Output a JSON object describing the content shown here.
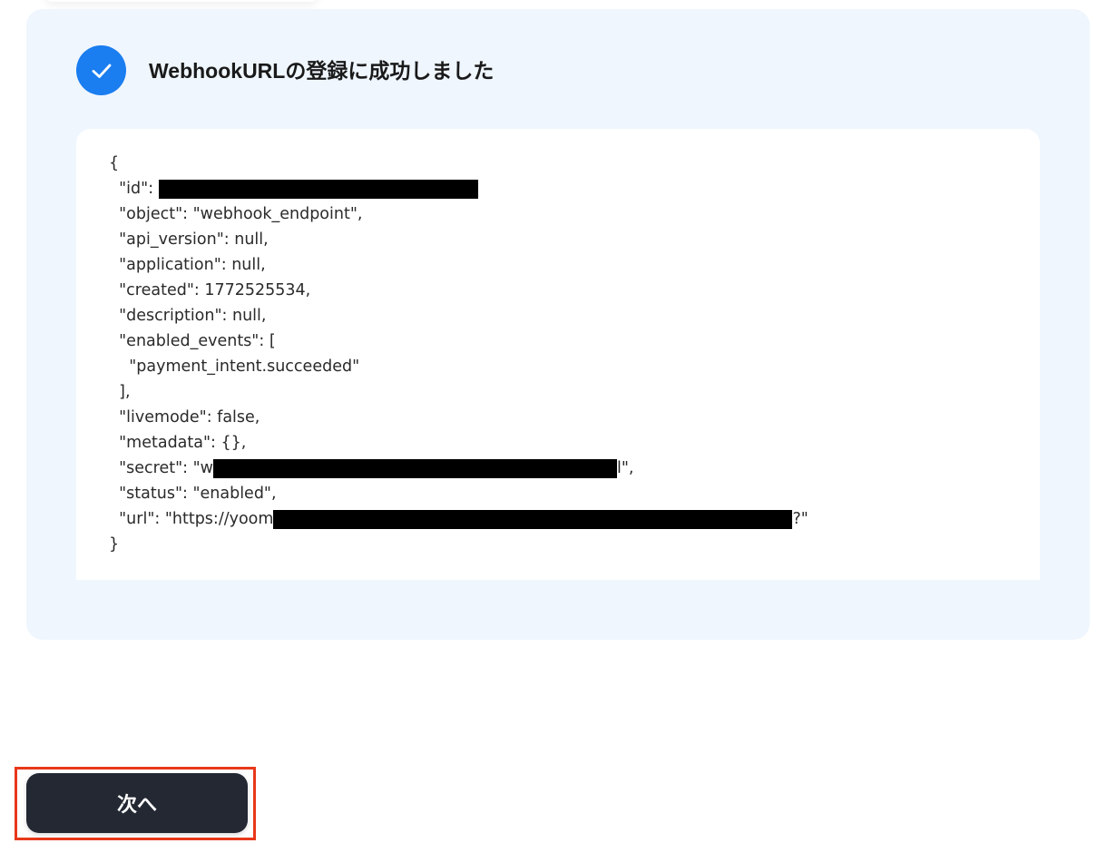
{
  "header": {
    "title": "WebhookURLの登録に成功しました"
  },
  "response": {
    "open_brace": "{",
    "id_prefix": "  \"id\": ",
    "object": "  \"object\": \"webhook_endpoint\",",
    "api_version": "  \"api_version\": null,",
    "application": "  \"application\": null,",
    "created": "  \"created\": 1772525534,",
    "description": "  \"description\": null,",
    "enabled_events_open": "  \"enabled_events\": [",
    "enabled_event_0": "    \"payment_intent.succeeded\"",
    "enabled_events_close": "  ],",
    "livemode": "  \"livemode\": false,",
    "metadata": "  \"metadata\": {},",
    "secret_prefix": "  \"secret\": \"w",
    "secret_suffix": "l\",",
    "status": "  \"status\": \"enabled\",",
    "url_prefix": "  \"url\": \"https://yoom",
    "url_suffix": "?\"",
    "close_brace": "}"
  },
  "actions": {
    "next_label": "次へ"
  },
  "colors": {
    "panel_bg": "#eff6fe",
    "accent": "#1a7df0",
    "button_bg": "#232833",
    "highlight": "#e8381a"
  },
  "icons": {
    "success": "check-icon"
  }
}
